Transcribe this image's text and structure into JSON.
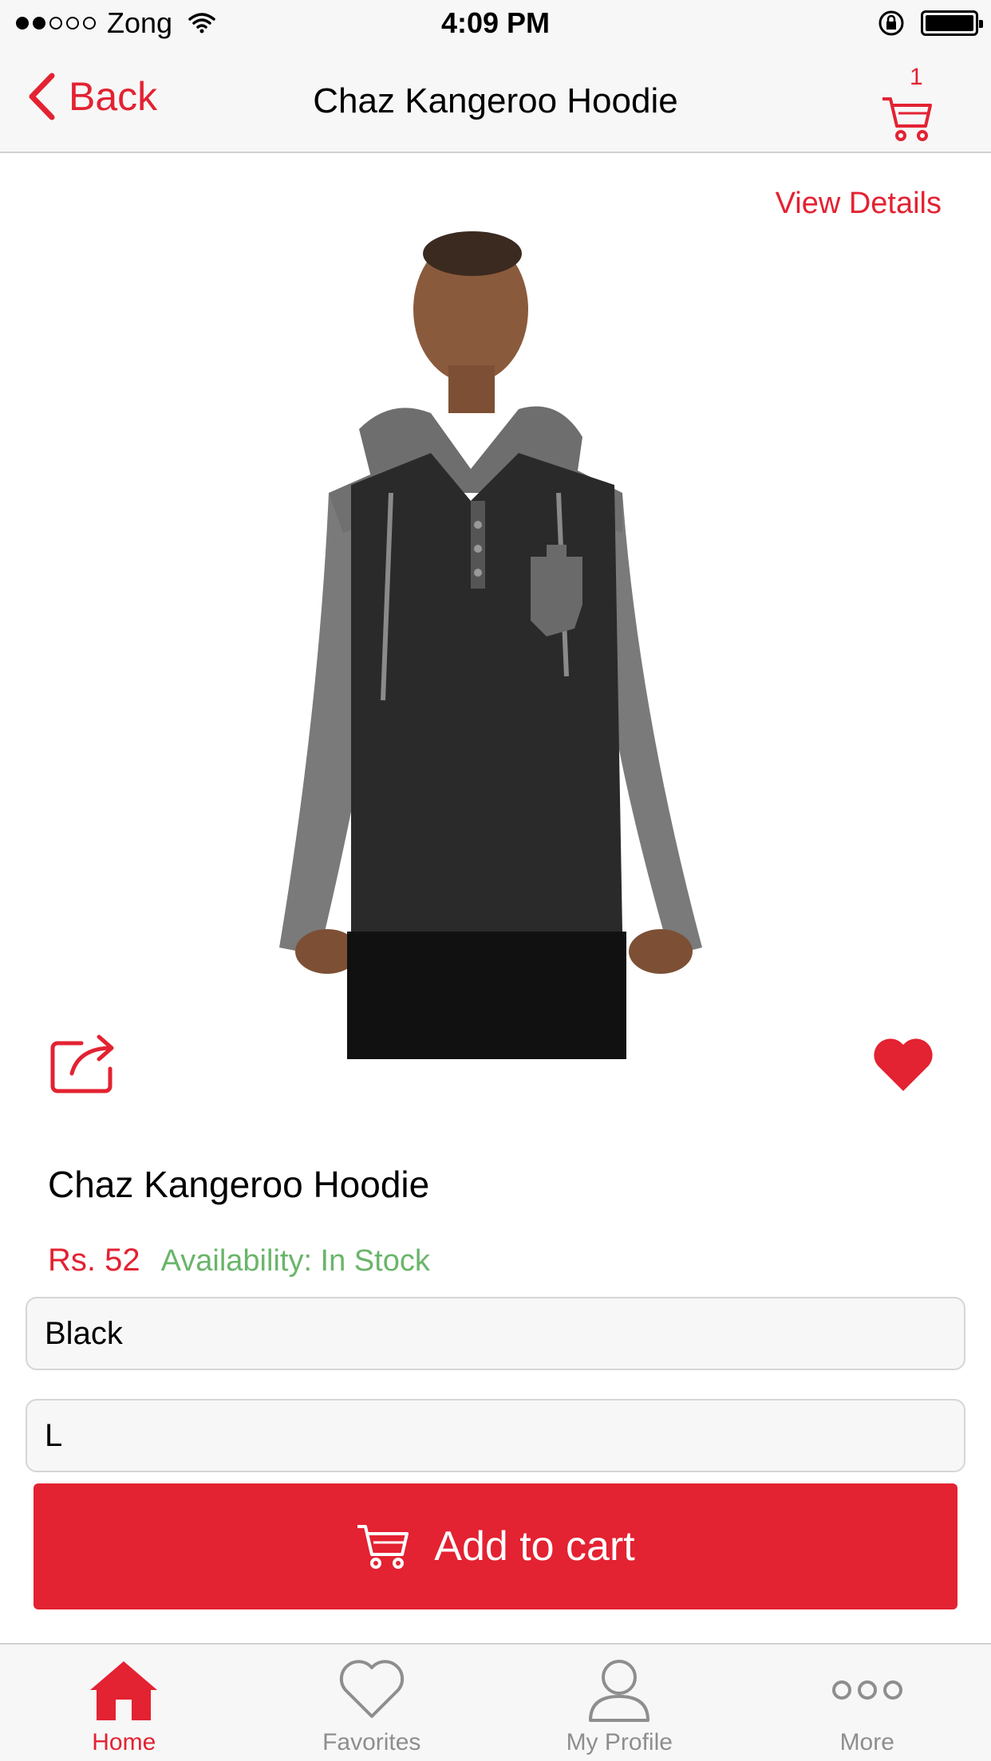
{
  "status_bar": {
    "carrier": "Zong",
    "time": "4:09 PM",
    "signal_strength": 2,
    "signal_total": 5,
    "battery_level": 1.0
  },
  "nav": {
    "back_label": "Back",
    "title": "Chaz Kangeroo Hoodie",
    "cart_count": "1"
  },
  "product": {
    "view_details_label": "View Details",
    "name": "Chaz Kangeroo Hoodie",
    "price": "Rs. 52",
    "availability": "Availability: In Stock",
    "is_favorite": true,
    "color_option": "Black",
    "size_option": "L",
    "add_to_cart_label": "Add to cart"
  },
  "tabs": [
    {
      "label": "Home",
      "icon": "home-icon",
      "active": true
    },
    {
      "label": "Favorites",
      "icon": "heart-icon",
      "active": false
    },
    {
      "label": "My Profile",
      "icon": "user-icon",
      "active": false
    },
    {
      "label": "More",
      "icon": "more-icon",
      "active": false
    }
  ],
  "colors": {
    "accent": "#e32232",
    "availability": "#6ab56a",
    "inactive_tab": "#8e8e8e",
    "bar_background": "#f7f7f7"
  }
}
